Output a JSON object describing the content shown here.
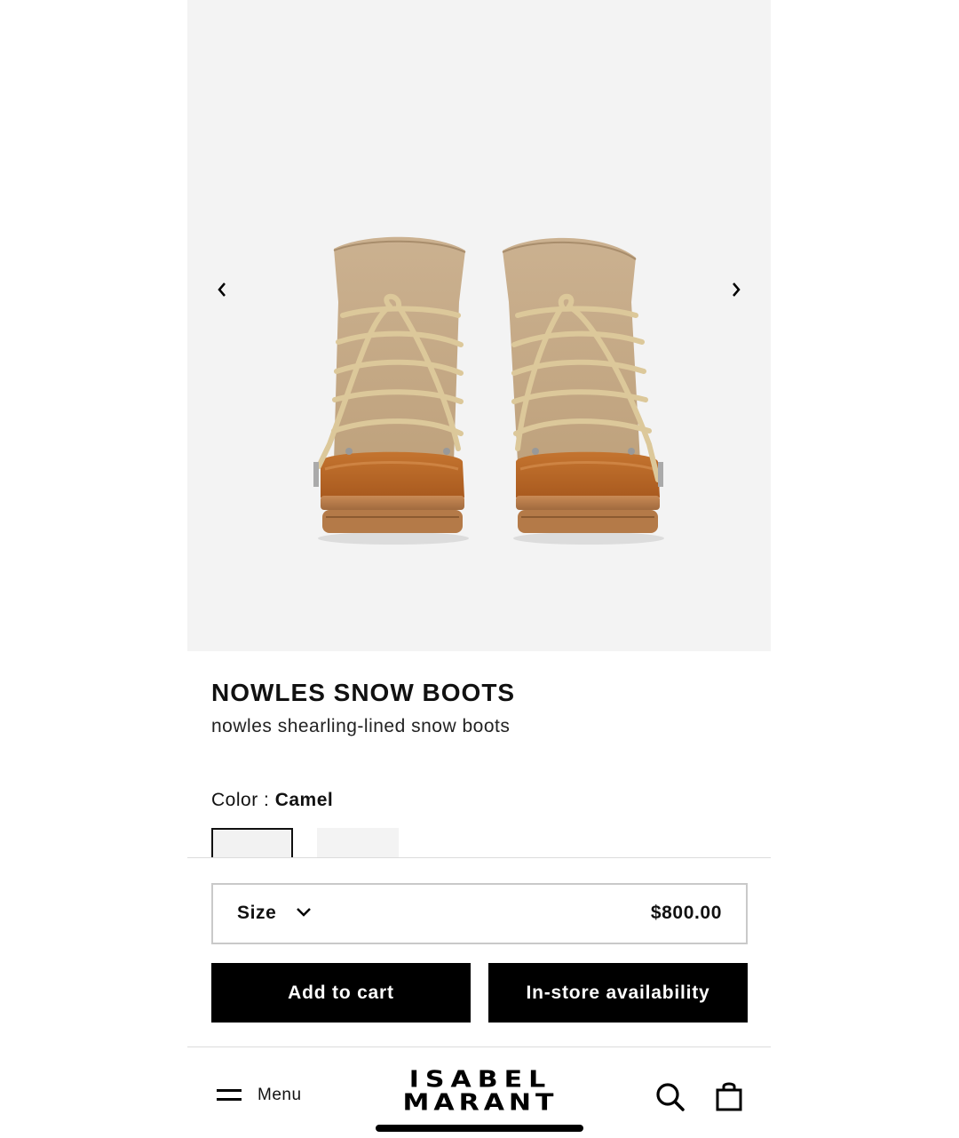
{
  "gallery": {
    "prev_icon": "chevron-left-icon",
    "next_icon": "chevron-right-icon"
  },
  "product": {
    "name": "NOWLES SNOW BOOTS",
    "description": "nowles shearling-lined snow boots",
    "color_label": "Color : ",
    "color_value": "Camel",
    "swatches": [
      "Camel",
      "Secondary color"
    ]
  },
  "purchase": {
    "size_label": "Size",
    "size_icon": "chevron-down-icon",
    "price": "$800.00",
    "add_to_cart": "Add to cart",
    "in_store": "In-store availability"
  },
  "nav": {
    "menu_label": "Menu",
    "logo_line1": "ISABEL",
    "logo_line2": "MARANT",
    "search_icon": "search-icon",
    "bag_icon": "shopping-bag-icon"
  },
  "colors": {
    "accent": "#000000",
    "gallery_bg": "#f3f3f3",
    "leather": "#b8662a",
    "suede": "#c8ad8a"
  }
}
